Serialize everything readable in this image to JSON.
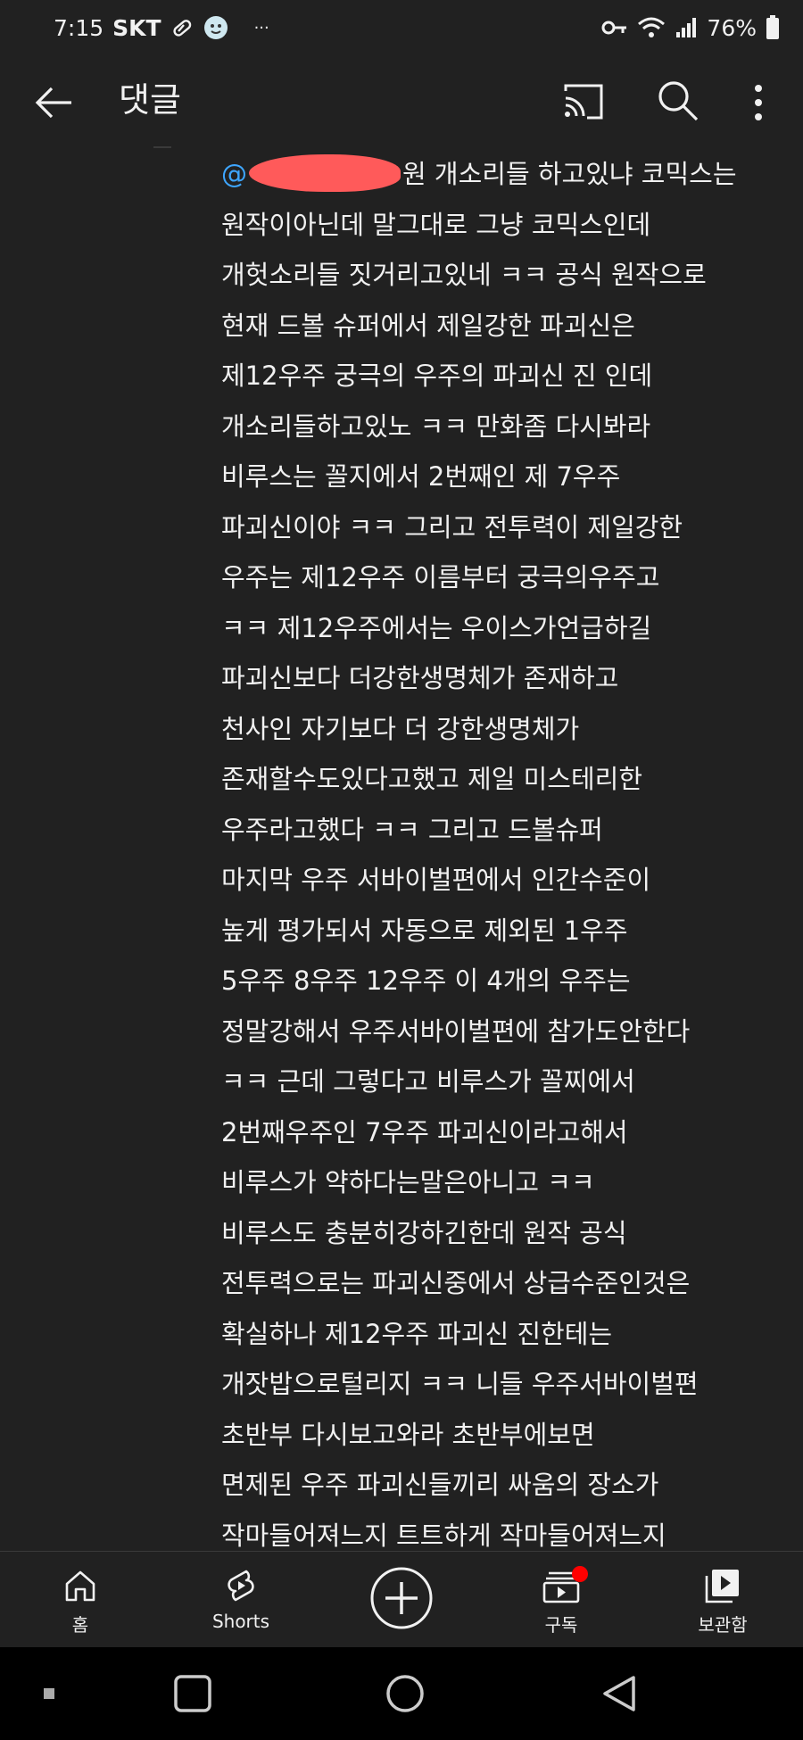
{
  "status_bar": {
    "time": "7:15",
    "carrier": "SKT",
    "dots": "···",
    "battery": "76%"
  },
  "header": {
    "title": "댓글"
  },
  "comment": {
    "mention_prefix": "@",
    "first_line_rest": "원 개소리들 하고있냐  코믹스는",
    "lines": [
      "원작이아닌데 말그대로 그냥 코믹스인데",
      "개헛소리들 짓거리고있네 ㅋㅋ 공식 원작으로",
      "현재 드볼 슈퍼에서 제일강한 파괴신은",
      "제12우주 궁극의 우주의 파괴신 진 인데",
      "개소리들하고있노 ㅋㅋ  만화좀 다시봐라",
      "비루스는 꼴지에서 2번째인 제 7우주",
      "파괴신이야 ㅋㅋ  그리고 전투력이 제일강한",
      "우주는 제12우주 이름부터 궁극의우주고",
      "ㅋㅋ 제12우주에서는 우이스가언급하길",
      "파괴신보다 더강한생명체가 존재하고",
      "천사인 자기보다 더 강한생명체가",
      "존재할수도있다고했고 제일 미스테리한",
      "우주라고했다 ㅋㅋ 그리고 드볼슈퍼",
      "마지막 우주 서바이벌편에서 인간수준이",
      "높게 평가되서 자동으로 제외된 1우주",
      "5우주 8우주 12우주  이 4개의 우주는",
      "정말강해서 우주서바이벌편에 참가도안한다",
      "ㅋㅋ 근데 그렇다고 비루스가 꼴찌에서",
      "2번째우주인 7우주 파괴신이라고해서",
      "비루스가 약하다는말은아니고 ㅋㅋ",
      "비루스도 충분히강하긴한데 원작 공식",
      "전투력으로는 파괴신중에서 상급수준인것은",
      "확실하나  제12우주 파괴신 진한테는",
      "개잣밥으로털리지  ㅋㅋ 니들 우주서바이벌편",
      "초반부 다시보고와라  초반부에보면",
      "면제된 우주 파괴신들끼리  싸움의 장소가",
      "작마들어져느지  트트하게 작마들어져느지"
    ]
  },
  "bottom_nav": {
    "home": "홈",
    "shorts": "Shorts",
    "subscriptions": "구독",
    "library": "보관함"
  },
  "colors": {
    "background": "#212121",
    "mention": "#3ea6ff",
    "notification_dot": "#ff0000"
  }
}
